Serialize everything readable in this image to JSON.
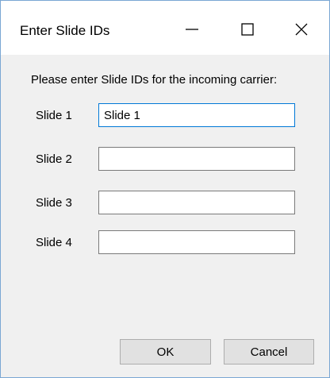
{
  "window": {
    "title": "Enter Slide IDs",
    "controls": {
      "minimize_icon": "minimize-icon",
      "maximize_icon": "maximize-icon",
      "close_icon": "close-icon"
    }
  },
  "form": {
    "instruction": "Please enter Slide IDs for the incoming carrier:",
    "rows": [
      {
        "label": "Slide 1",
        "value": "Slide 1"
      },
      {
        "label": "Slide 2",
        "value": ""
      },
      {
        "label": "Slide 3",
        "value": ""
      },
      {
        "label": "Slide 4",
        "value": ""
      }
    ]
  },
  "buttons": {
    "ok_label": "OK",
    "cancel_label": "Cancel"
  },
  "colors": {
    "focus_border": "#0078d7",
    "window_border": "#7aa7d4",
    "dialog_background": "#f0f0f0"
  }
}
